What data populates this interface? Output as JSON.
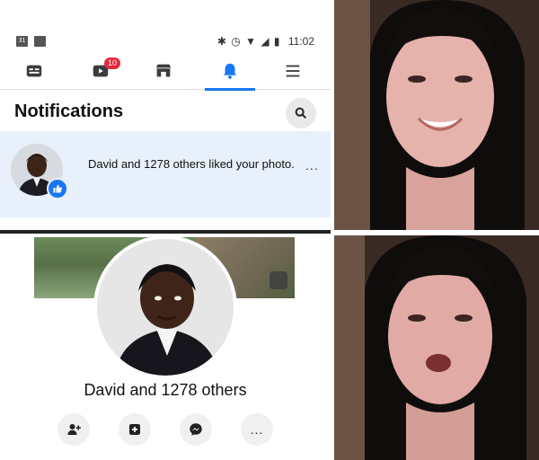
{
  "status_bar": {
    "calendar_day": "31",
    "time": "11:02",
    "icons": [
      "calendar-icon",
      "image-icon",
      "bluetooth-icon",
      "alarm-icon",
      "wifi-icon",
      "signal-icon",
      "battery-icon"
    ]
  },
  "tabs": [
    {
      "name": "feed-tab",
      "icon": "news-feed-icon"
    },
    {
      "name": "watch-tab",
      "icon": "video-icon",
      "badge": "10"
    },
    {
      "name": "marketplace-tab",
      "icon": "store-icon"
    },
    {
      "name": "notifications-tab",
      "icon": "bell-icon",
      "active": true
    },
    {
      "name": "menu-tab",
      "icon": "hamburger-icon"
    }
  ],
  "notifications": {
    "header": "Notifications",
    "item": {
      "text": "David and 1278 others liked your photo.",
      "reaction": "like-icon",
      "more": "..."
    }
  },
  "profile": {
    "name": "David and 1278 others",
    "actions": [
      "add-friend-icon",
      "message-box-icon",
      "messenger-icon",
      "more-icon"
    ],
    "more_label": "..."
  },
  "colors": {
    "facebook_blue": "#1877f2",
    "notification_bg": "#e7f0fb",
    "badge_red": "#e4283a"
  }
}
